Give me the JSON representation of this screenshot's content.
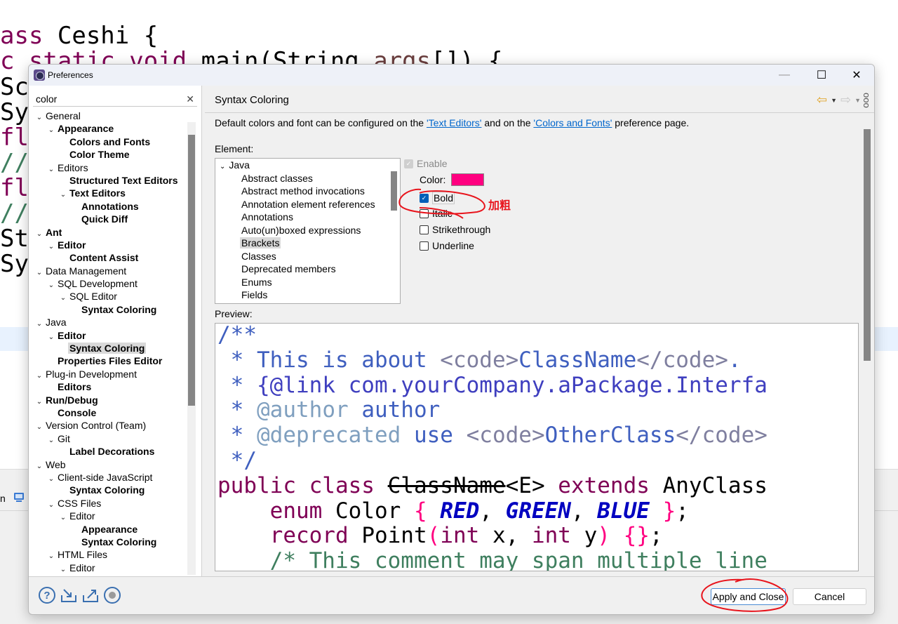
{
  "background_editor": {
    "lines": [
      {
        "parts": [
          {
            "t": "ass ",
            "c": "kw"
          },
          {
            "t": "Ceshi {",
            "c": "pl"
          }
        ]
      },
      {
        "parts": [
          {
            "t": "c ",
            "c": "kw"
          },
          {
            "t": "static void ",
            "c": "kw"
          },
          {
            "t": "main(String ",
            "c": "pl"
          },
          {
            "t": "args",
            "c": "br"
          },
          {
            "t": "[]) {",
            "c": "pl"
          }
        ]
      },
      {
        "parts": [
          {
            "t": "Sca",
            "c": "pl"
          }
        ]
      },
      {
        "parts": [
          {
            "t": "Sys",
            "c": "pl"
          }
        ]
      },
      {
        "parts": [
          {
            "t": "flo",
            "c": "kw"
          }
        ]
      },
      {
        "parts": [
          {
            "t": "//",
            "c": "gr"
          }
        ]
      },
      {
        "parts": [
          {
            "t": "flo",
            "c": "kw"
          }
        ]
      },
      {
        "parts": [
          {
            "t": "//",
            "c": "gr"
          }
        ]
      },
      {
        "parts": [
          {
            "t": "Str",
            "c": "pl"
          }
        ]
      },
      {
        "parts": [
          {
            "t": "Sys",
            "c": "pl"
          }
        ]
      }
    ],
    "bottom_text": "n"
  },
  "dialog": {
    "title": "Preferences",
    "window_controls": {
      "minimize": "—",
      "maximize": "☐",
      "close": "✕"
    },
    "filter": {
      "value": "color",
      "clear_icon": "✕"
    },
    "tree": [
      {
        "label": "General",
        "level": 0,
        "expanded": true,
        "bold": false
      },
      {
        "label": "Appearance",
        "level": 1,
        "expanded": true,
        "bold": true
      },
      {
        "label": "Colors and Fonts",
        "level": 2,
        "bold": true
      },
      {
        "label": "Color Theme",
        "level": 2,
        "bold": true
      },
      {
        "label": "Editors",
        "level": 1,
        "expanded": true,
        "bold": false
      },
      {
        "label": "Structured Text Editors",
        "level": 2,
        "bold": true
      },
      {
        "label": "Text Editors",
        "level": 2,
        "expanded": true,
        "bold": true
      },
      {
        "label": "Annotations",
        "level": 3,
        "bold": true
      },
      {
        "label": "Quick Diff",
        "level": 3,
        "bold": true
      },
      {
        "label": "Ant",
        "level": 0,
        "expanded": true,
        "bold": true
      },
      {
        "label": "Editor",
        "level": 1,
        "expanded": true,
        "bold": true
      },
      {
        "label": "Content Assist",
        "level": 2,
        "bold": true
      },
      {
        "label": "Data Management",
        "level": 0,
        "expanded": true,
        "bold": false
      },
      {
        "label": "SQL Development",
        "level": 1,
        "expanded": true,
        "bold": false
      },
      {
        "label": "SQL Editor",
        "level": 2,
        "expanded": true,
        "bold": false
      },
      {
        "label": "Syntax Coloring",
        "level": 3,
        "bold": true
      },
      {
        "label": "Java",
        "level": 0,
        "expanded": true,
        "bold": false
      },
      {
        "label": "Editor",
        "level": 1,
        "expanded": true,
        "bold": true
      },
      {
        "label": "Syntax Coloring",
        "level": 2,
        "bold": true,
        "selected": true
      },
      {
        "label": "Properties Files Editor",
        "level": 1,
        "bold": true
      },
      {
        "label": "Plug-in Development",
        "level": 0,
        "expanded": true,
        "bold": false
      },
      {
        "label": "Editors",
        "level": 1,
        "bold": true
      },
      {
        "label": "Run/Debug",
        "level": 0,
        "expanded": true,
        "bold": true
      },
      {
        "label": "Console",
        "level": 1,
        "bold": true
      },
      {
        "label": "Version Control (Team)",
        "level": 0,
        "expanded": true,
        "bold": false
      },
      {
        "label": "Git",
        "level": 1,
        "expanded": true,
        "bold": false
      },
      {
        "label": "Label Decorations",
        "level": 2,
        "bold": true
      },
      {
        "label": "Web",
        "level": 0,
        "expanded": true,
        "bold": false
      },
      {
        "label": "Client-side JavaScript",
        "level": 1,
        "expanded": true,
        "bold": false
      },
      {
        "label": "Syntax Coloring",
        "level": 2,
        "bold": true
      },
      {
        "label": "CSS Files",
        "level": 1,
        "expanded": true,
        "bold": false
      },
      {
        "label": "Editor",
        "level": 2,
        "expanded": true,
        "bold": false
      },
      {
        "label": "Appearance",
        "level": 3,
        "bold": true
      },
      {
        "label": "Syntax Coloring",
        "level": 3,
        "bold": true
      },
      {
        "label": "HTML Files",
        "level": 1,
        "expanded": true,
        "bold": false
      },
      {
        "label": "Editor",
        "level": 2,
        "expanded": true,
        "bold": false
      }
    ],
    "page": {
      "title": "Syntax Coloring",
      "description_prefix": "Default colors and font can be configured on the ",
      "link1": "'Text Editors'",
      "description_middle": " and on the ",
      "link2": "'Colors and Fonts'",
      "description_suffix": " preference page.",
      "element_label": "Element:",
      "element_root": "Java",
      "elements": [
        "Abstract classes",
        "Abstract method invocations",
        "Annotation element references",
        "Annotations",
        "Auto(un)boxed expressions",
        "Brackets",
        "Classes",
        "Deprecated members",
        "Enums",
        "Fields"
      ],
      "selected_element": "Brackets",
      "options": {
        "enable": {
          "label": "Enable",
          "checked": true,
          "disabled": true
        },
        "color_label": "Color:",
        "color_value": "#ff0080",
        "bold": {
          "label": "Bold",
          "checked": true
        },
        "italic": {
          "label": "Italic",
          "checked": false
        },
        "strikethrough": {
          "label": "Strikethrough",
          "checked": false
        },
        "underline": {
          "label": "Underline",
          "checked": false
        }
      },
      "preview_label": "Preview:",
      "preview_lines": [
        [
          {
            "t": "/**",
            "c": "doc"
          }
        ],
        [
          {
            "t": " * ",
            "c": "doc"
          },
          {
            "t": "This is about ",
            "c": "doc"
          },
          {
            "t": "<code>",
            "c": "tag"
          },
          {
            "t": "ClassName",
            "c": "doc"
          },
          {
            "t": "</code>",
            "c": "tag"
          },
          {
            "t": ".",
            "c": "doc"
          }
        ],
        [
          {
            "t": " * ",
            "c": "doc"
          },
          {
            "t": "{@link com.yourCompany.aPackage.Interfa",
            "c": "lnk"
          }
        ],
        [
          {
            "t": " * ",
            "c": "doc"
          },
          {
            "t": "@author",
            "c": "kwd"
          },
          {
            "t": " author",
            "c": "doc"
          }
        ],
        [
          {
            "t": " * ",
            "c": "doc"
          },
          {
            "t": "@deprecated",
            "c": "kwd"
          },
          {
            "t": " use ",
            "c": "doc"
          },
          {
            "t": "<code>",
            "c": "tag"
          },
          {
            "t": "OtherClass",
            "c": "doc"
          },
          {
            "t": "</code>",
            "c": "tag"
          }
        ],
        [
          {
            "t": " */",
            "c": "doc"
          }
        ],
        [
          {
            "t": "public class ",
            "c": "kw"
          },
          {
            "t": "ClassName",
            "c": "pl dep"
          },
          {
            "t": "<E> ",
            "c": "pl"
          },
          {
            "t": "extends ",
            "c": "kw"
          },
          {
            "t": "AnyClass",
            "c": "pl"
          }
        ],
        [
          {
            "t": "    enum ",
            "c": "kw"
          },
          {
            "t": "Color ",
            "c": "pl"
          },
          {
            "t": "{ ",
            "c": "br"
          },
          {
            "t": "RED",
            "c": "enum"
          },
          {
            "t": ", ",
            "c": "pl"
          },
          {
            "t": "GREEN",
            "c": "enum"
          },
          {
            "t": ", ",
            "c": "pl"
          },
          {
            "t": "BLUE",
            "c": "enum"
          },
          {
            "t": " }",
            "c": "br"
          },
          {
            "t": ";",
            "c": "pl"
          }
        ],
        [
          {
            "t": "    record ",
            "c": "kw"
          },
          {
            "t": "Point",
            "c": "pl"
          },
          {
            "t": "(",
            "c": "br"
          },
          {
            "t": "int ",
            "c": "kw"
          },
          {
            "t": "x, ",
            "c": "pl"
          },
          {
            "t": "int ",
            "c": "kw"
          },
          {
            "t": "y",
            "c": "pl"
          },
          {
            "t": ") {}",
            "c": "br"
          },
          {
            "t": ";",
            "c": "pl"
          }
        ],
        [
          {
            "t": "    /* This comment may span multiple line",
            "c": "cm"
          }
        ]
      ]
    },
    "buttons": {
      "apply_close": "Apply and Close",
      "cancel": "Cancel"
    },
    "bottom_icons": [
      "help-icon",
      "import-icon",
      "export-icon",
      "record-icon"
    ]
  },
  "annotations": {
    "handwritten_note": "加粗",
    "stroke_color": "#e8141c"
  }
}
